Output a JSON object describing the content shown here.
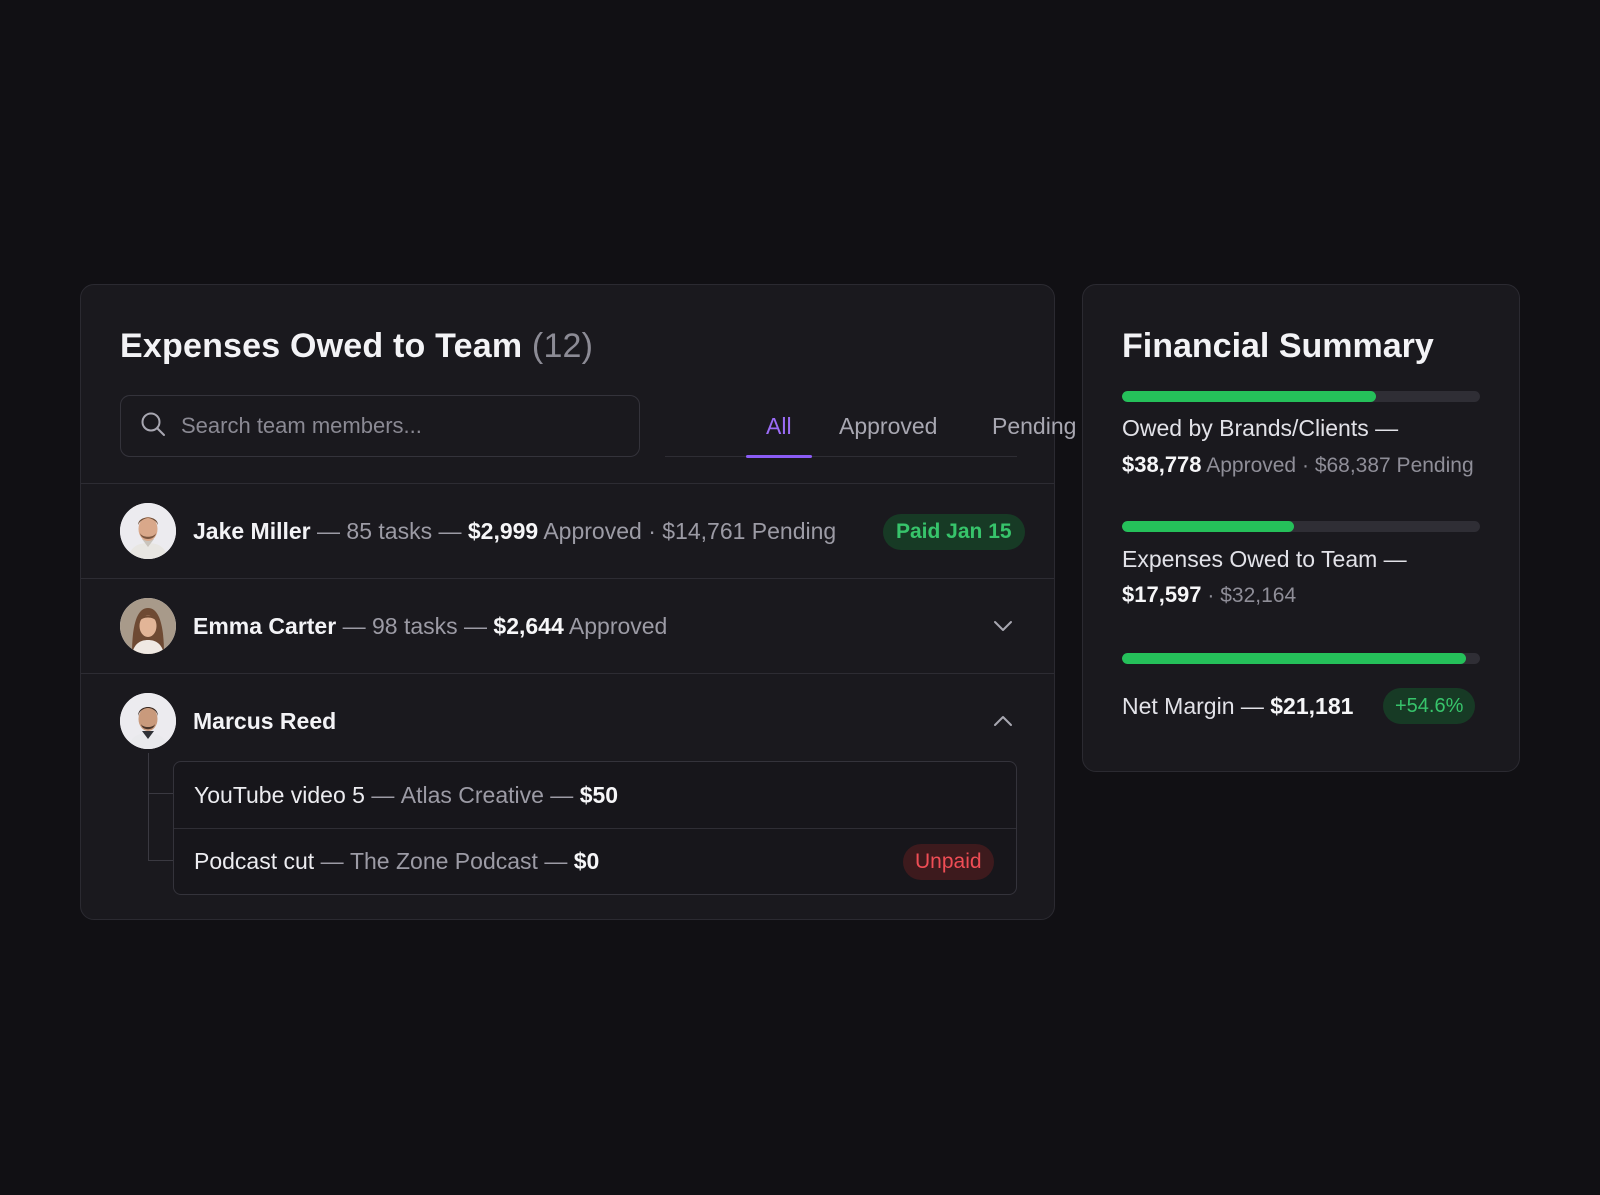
{
  "expenses": {
    "title": "Expenses Owed to Team",
    "count": "(12)",
    "search": {
      "placeholder": "Search team members..."
    },
    "tabs": [
      {
        "label": "All",
        "active": true
      },
      {
        "label": "Approved",
        "active": false
      },
      {
        "label": "Pending",
        "active": false
      }
    ],
    "rows": [
      {
        "name": "Jake Miller",
        "tasks": "85 tasks",
        "approved_amount": "$2,999",
        "approved_label": "Approved",
        "pending_amount": "$14,761",
        "pending_label": "Pending",
        "badge": "Paid Jan 15"
      },
      {
        "name": "Emma Carter",
        "tasks": "98 tasks",
        "approved_amount": "$2,644",
        "approved_label": "Approved",
        "chevron": "chevron-down-icon"
      },
      {
        "name": "Marcus Reed",
        "chevron": "chevron-up-icon",
        "subitems": [
          {
            "title": "YouTube video 5",
            "client": "Atlas Creative",
            "amount": "$50"
          },
          {
            "title": "Podcast cut",
            "client": "The Zone Podcast",
            "amount": "$0",
            "badge": "Unpaid"
          }
        ]
      }
    ],
    "separator": "—",
    "dot": "·"
  },
  "summary": {
    "title": "Financial Summary",
    "owed_by_clients": {
      "label": "Owed by Brands/Clients —",
      "approved_amount": "$38,778",
      "approved_label": "Approved",
      "pending_text": "$68,387 Pending",
      "progress": 0.71
    },
    "owed_to_team": {
      "label": "Expenses Owed to Team —",
      "amount": "$17,597",
      "total": "$32,164",
      "progress": 0.48
    },
    "net_margin": {
      "label": "Net Margin —",
      "amount": "$21,181",
      "badge": "+54.6%",
      "progress": 0.96
    }
  },
  "colors": {
    "background": "#111014",
    "card": "#1a191e",
    "accent": "#8b5cf6",
    "success": "#25c05a",
    "danger": "#ef4d55"
  }
}
